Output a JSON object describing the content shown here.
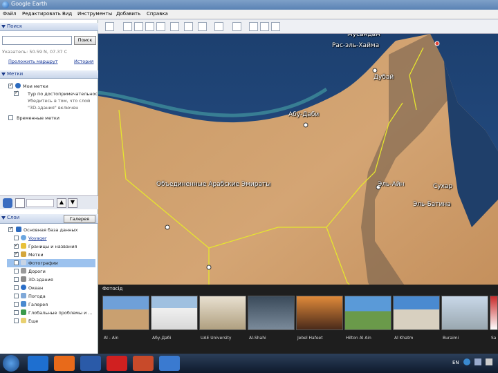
{
  "window": {
    "title": "Google Earth"
  },
  "menu": [
    "Файл",
    "Редактировать",
    "Вид",
    "Инструменты",
    "Добавить",
    "Справка"
  ],
  "search": {
    "header": "Поиск",
    "button": "Поиск",
    "pointer": "Указатель: 50.59 N, 07.37 C",
    "route_link": "Проложить маршрут",
    "history_link": "История"
  },
  "places": {
    "header": "Метки",
    "items": [
      {
        "label": "Мои метки"
      },
      {
        "label": "Тур по достопримечательнос"
      },
      {
        "label": "Убедитесь в том, что слой"
      },
      {
        "label": "\"3D-здания\" включен"
      },
      {
        "label": "Временные метки"
      }
    ]
  },
  "layers": {
    "header": "Слои",
    "gallery_button": "Галерея",
    "items": [
      {
        "label": "Основная база данных",
        "checked": true
      },
      {
        "label": "Voyager",
        "checked": false
      },
      {
        "label": "Границы и названия",
        "checked": true
      },
      {
        "label": "Метки",
        "checked": true
      },
      {
        "label": "Фотографии",
        "checked": false
      },
      {
        "label": "Дороги",
        "checked": false
      },
      {
        "label": "3D-здания",
        "checked": false
      },
      {
        "label": "Океан",
        "checked": false
      },
      {
        "label": "Погода",
        "checked": false
      },
      {
        "label": "Галерея",
        "checked": false
      },
      {
        "label": "Глобальные проблемы и ...",
        "checked": false
      },
      {
        "label": "Еще",
        "checked": false
      }
    ]
  },
  "map": {
    "labels": [
      {
        "text": "Мусандам"
      },
      {
        "text": "Рас-эль-Хайма"
      },
      {
        "text": "Дубай"
      },
      {
        "text": "Абу-Даби"
      },
      {
        "text": "Объединенные Арабские Эмираты"
      },
      {
        "text": "Эль-Айн"
      },
      {
        "text": "Сухар"
      },
      {
        "text": "Эль-Батина"
      }
    ]
  },
  "photos": {
    "header": "Фотосід",
    "items": [
      {
        "caption": "Al - Ain"
      },
      {
        "caption": "Абу-Дабі"
      },
      {
        "caption": "UAE University"
      },
      {
        "caption": "Al-Shahi"
      },
      {
        "caption": "Jebel Hafeet"
      },
      {
        "caption": "Hilton Al Ain"
      },
      {
        "caption": "Al Khatm"
      },
      {
        "caption": "Buraimi"
      },
      {
        "caption": "Sa"
      }
    ]
  },
  "taskbar": {
    "lang": "EN"
  }
}
